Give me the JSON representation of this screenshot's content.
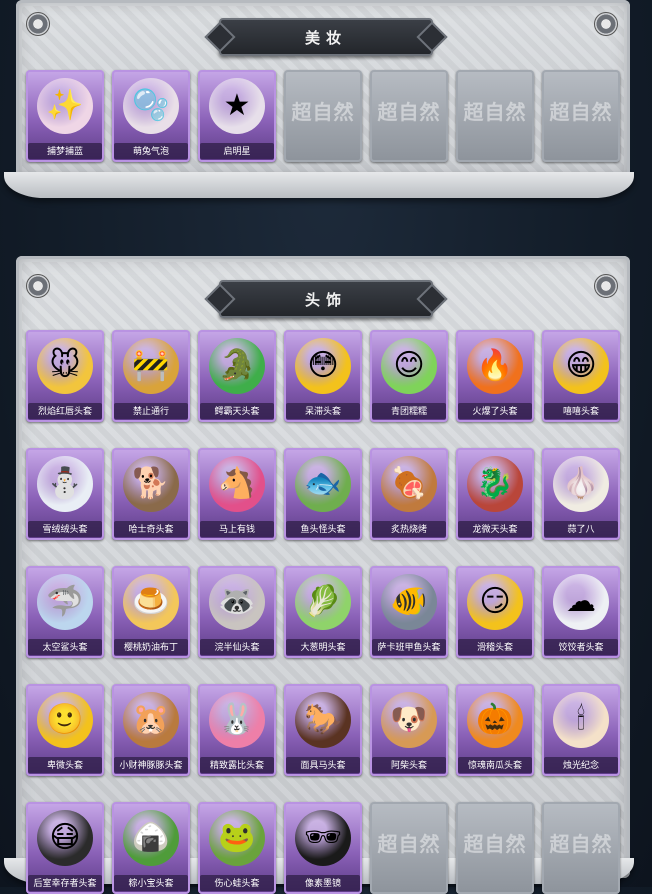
{
  "sections": {
    "makeup": {
      "title": "美妆",
      "items": [
        {
          "label": "捕梦捕蓝",
          "icon": "star-face-makeup-icon",
          "glyph": "✨",
          "color": "#efd6e6"
        },
        {
          "label": "萌兔气泡",
          "icon": "bubble-face-makeup-icon",
          "glyph": "🫧",
          "color": "#e9dfe8"
        },
        {
          "label": "启明星",
          "icon": "star-glasses-makeup-icon",
          "glyph": "★",
          "color": "#e7dfea"
        },
        {
          "label": "",
          "icon": "empty-slot-icon",
          "watermark": "超自然"
        },
        {
          "label": "",
          "icon": "empty-slot-icon",
          "watermark": "超自然"
        },
        {
          "label": "",
          "icon": "empty-slot-icon",
          "watermark": "超自然"
        },
        {
          "label": "",
          "icon": "empty-slot-icon",
          "watermark": "超自然"
        }
      ]
    },
    "headwear": {
      "title": "头饰",
      "items": [
        {
          "label": "烈焰红唇头套",
          "icon": "yellow-mouse-head-icon",
          "glyph": "🐭",
          "color": "#f2c53d"
        },
        {
          "label": "禁止通行",
          "icon": "traffic-cone-head-icon",
          "glyph": "🚧",
          "color": "#d9a33a"
        },
        {
          "label": "鳄霸天头套",
          "icon": "crocodile-head-icon",
          "glyph": "🐊",
          "color": "#3fae4a"
        },
        {
          "label": "呆滞头套",
          "icon": "dazed-emoji-head-icon",
          "glyph": "😳",
          "color": "#f3c21c"
        },
        {
          "label": "青团糯糯",
          "icon": "green-dumpling-head-icon",
          "glyph": "😊",
          "color": "#7fd35a"
        },
        {
          "label": "火爆了头套",
          "icon": "fire-head-icon",
          "glyph": "🔥",
          "color": "#f0711d"
        },
        {
          "label": "嘻嘻头套",
          "icon": "grinning-emoji-head-icon",
          "glyph": "😁",
          "color": "#f3c21c"
        },
        {
          "label": "雪绒绒头套",
          "icon": "snowman-head-icon",
          "glyph": "⛄",
          "color": "#e9eef5"
        },
        {
          "label": "哈士奇头套",
          "icon": "husky-head-icon",
          "glyph": "🐕",
          "color": "#8a6a4a"
        },
        {
          "label": "马上有钱",
          "icon": "pink-horse-head-icon",
          "glyph": "🐴",
          "color": "#e2508a"
        },
        {
          "label": "鱼头怪头套",
          "icon": "fish-monster-head-icon",
          "glyph": "🐟",
          "color": "#6fae4e"
        },
        {
          "label": "炙热烧烤",
          "icon": "grill-head-icon",
          "glyph": "🍖",
          "color": "#c07a3d"
        },
        {
          "label": "龙微天头套",
          "icon": "dragon-head-icon",
          "glyph": "🐉",
          "color": "#b9463a"
        },
        {
          "label": "蒜了八",
          "icon": "garlic-head-icon",
          "glyph": "🧄",
          "color": "#f0ece2"
        },
        {
          "label": "太空鲨头套",
          "icon": "shark-head-icon",
          "glyph": "🦈",
          "color": "#bcd6ee"
        },
        {
          "label": "樱桃奶油布丁",
          "icon": "pudding-head-icon",
          "glyph": "🍮",
          "color": "#f3c75a"
        },
        {
          "label": "浣半仙头套",
          "icon": "raccoon-head-icon",
          "glyph": "🦝",
          "color": "#c9c4c0"
        },
        {
          "label": "大葱明头套",
          "icon": "green-onion-head-icon",
          "glyph": "🥬",
          "color": "#8fd36a"
        },
        {
          "label": "萨卡班甲鱼头套",
          "icon": "sacabambaspis-head-icon",
          "glyph": "🐠",
          "color": "#7a8797"
        },
        {
          "label": "滑稽头套",
          "icon": "funny-emoji-head-icon",
          "glyph": "😏",
          "color": "#f3c21c"
        },
        {
          "label": "饺饺者头套",
          "icon": "cloud-head-icon",
          "glyph": "☁",
          "color": "#eef0f4"
        },
        {
          "label": "卑微头套",
          "icon": "humble-emoji-head-icon",
          "glyph": "🙂",
          "color": "#f3c21c"
        },
        {
          "label": "小财神豚豚头套",
          "icon": "capybara-head-icon",
          "glyph": "🐹",
          "color": "#b97a3e"
        },
        {
          "label": "精致露比头套",
          "icon": "pink-beaver-head-icon",
          "glyph": "🐰",
          "color": "#ee7fa8"
        },
        {
          "label": "面具马头套",
          "icon": "horse-mask-head-icon",
          "glyph": "🐎",
          "color": "#5a3322"
        },
        {
          "label": "阿柴头套",
          "icon": "shiba-head-icon",
          "glyph": "🐶",
          "color": "#d79a55"
        },
        {
          "label": "惊魂南瓜头套",
          "icon": "pumpkin-head-icon",
          "glyph": "🎃",
          "color": "#ef8a1f"
        },
        {
          "label": "烛光纪念",
          "icon": "candle-head-icon",
          "glyph": "🕯",
          "color": "#f4e1c9"
        },
        {
          "label": "后室幸存者头套",
          "icon": "gas-mask-head-icon",
          "glyph": "😷",
          "color": "#2b2b2b"
        },
        {
          "label": "粽小宝头套",
          "icon": "zongzi-head-icon",
          "glyph": "🍙",
          "color": "#4f9c3a"
        },
        {
          "label": "伤心蛙头套",
          "icon": "sad-frog-head-icon",
          "glyph": "🐸",
          "color": "#6aa33c"
        },
        {
          "label": "像素墨镜",
          "icon": "pixel-sunglasses-icon",
          "glyph": "🕶",
          "color": "#1a1a1a"
        },
        {
          "label": "",
          "icon": "empty-slot-icon",
          "watermark": "超自然"
        },
        {
          "label": "",
          "icon": "empty-slot-icon",
          "watermark": "超自然"
        },
        {
          "label": "",
          "icon": "empty-slot-icon",
          "watermark": "超自然"
        }
      ]
    }
  }
}
